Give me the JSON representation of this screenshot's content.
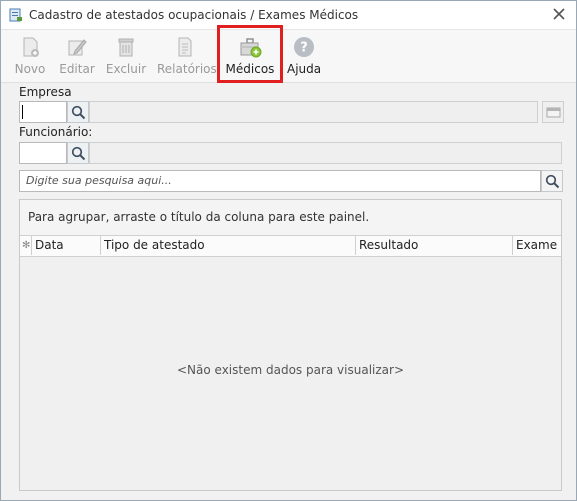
{
  "window": {
    "title": "Cadastro de atestados ocupacionais / Exames Médicos"
  },
  "toolbar": {
    "buttons": [
      {
        "label": "Novo",
        "icon": "new-doc-icon",
        "enabled": false
      },
      {
        "label": "Editar",
        "icon": "edit-pencil-icon",
        "enabled": false
      },
      {
        "label": "Excluir",
        "icon": "trash-icon",
        "enabled": false
      },
      {
        "label": "Relatórios",
        "icon": "report-icon",
        "enabled": false
      },
      {
        "label": "Médicos",
        "icon": "doctor-kit-icon",
        "enabled": true
      },
      {
        "label": "Ajuda",
        "icon": "help-icon",
        "enabled": true
      }
    ]
  },
  "form": {
    "empresa_label": "Empresa",
    "funcionario_label": "Funcionário:",
    "search_placeholder": "Digite sua pesquisa aqui..."
  },
  "grid": {
    "group_hint": "Para agrupar, arraste o título da coluna para este painel.",
    "columns": [
      "Data",
      "Tipo de atestado",
      "Resultado",
      "Exame"
    ],
    "empty_message": "<Não existem dados para visualizar>"
  },
  "colors": {
    "highlight": "#e02020",
    "help_icon": "#b8bec4",
    "kit_green": "#8cc43c"
  }
}
